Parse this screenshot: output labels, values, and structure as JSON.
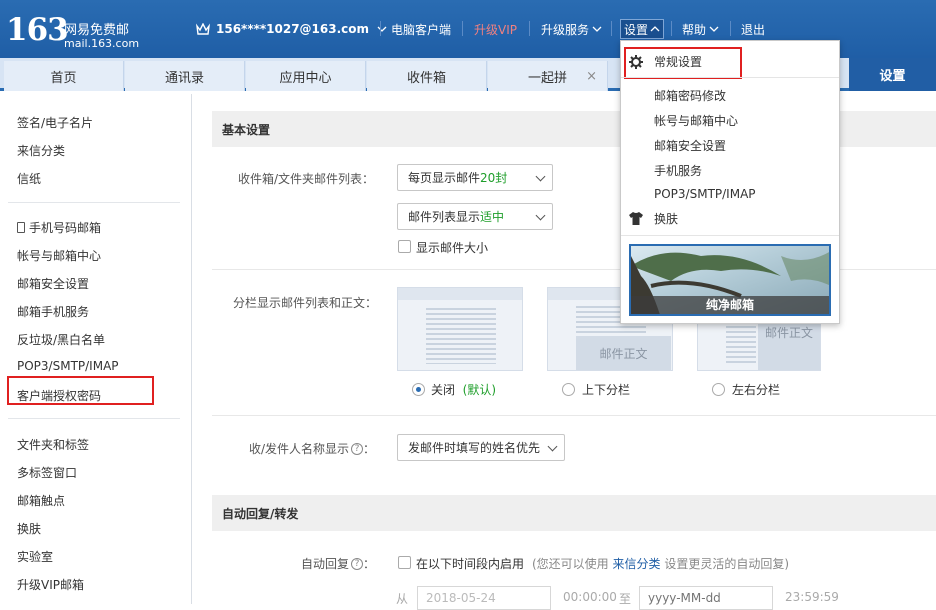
{
  "header": {
    "logo_number": "163",
    "logo_cn": "网易免费邮",
    "logo_domain": "mail.163.com",
    "account": "156****1027@163.com",
    "nav": [
      "电脑客户端",
      "升级VIP",
      "升级服务",
      "设置",
      "帮助",
      "退出"
    ]
  },
  "tabs": [
    "首页",
    "通讯录",
    "应用中心",
    "收件箱",
    "一起拼"
  ],
  "tab_close": "×",
  "tab_settings": "设置",
  "sidebar": {
    "group1": [
      "签名/电子名片",
      "来信分类",
      "信纸"
    ],
    "group2": [
      "手机号码邮箱",
      "帐号与邮箱中心",
      "邮箱安全设置",
      "邮箱手机服务",
      "反垃圾/黑白名单",
      "POP3/SMTP/IMAP",
      "客户端授权密码"
    ],
    "group3": [
      "文件夹和标签",
      "多标签窗口",
      "邮箱触点",
      "换肤",
      "实验室",
      "升级VIP邮箱"
    ]
  },
  "main": {
    "basic_title": "基本设置",
    "list_label": "收件箱/文件夹邮件列表：",
    "per_page_prefix": "每页显示邮件",
    "per_page_value": "20封",
    "density_prefix": "邮件列表显示",
    "density_value": "适中",
    "show_size": "显示邮件大小",
    "split_label": "分栏显示邮件列表和正文：",
    "preview_body": "邮件正文",
    "layout_off": "关闭",
    "layout_default": "(默认)",
    "layout_vertical": "上下分栏",
    "layout_horizontal": "左右分栏",
    "name_label": "收/发件人名称显示",
    "name_value": "发邮件时填写的姓名优先",
    "auto_title": "自动回复/转发",
    "auto_label": "自动回复",
    "auto_enable": "在以下时间段内启用",
    "auto_note_pre": "(您还可以使用",
    "auto_note_link": "来信分类",
    "auto_note_post": "设置更灵活的自动回复)",
    "from_label": "从",
    "start_date": "2018-05-24",
    "start_time": "00:00:00",
    "to_label": "至",
    "end_date_placeholder": "yyyy-MM-dd",
    "end_time": "23:59:59"
  },
  "dropdown": {
    "general": "常规设置",
    "items": [
      "邮箱密码修改",
      "帐号与邮箱中心",
      "邮箱安全设置",
      "手机服务",
      "POP3/SMTP/IMAP",
      "换肤"
    ],
    "skin_caption": "纯净邮箱"
  },
  "colors": {
    "header_blue": "#2a6cb2",
    "vip": "#f08080",
    "highlight_red": "#e02020",
    "green": "#1e9e2a"
  }
}
